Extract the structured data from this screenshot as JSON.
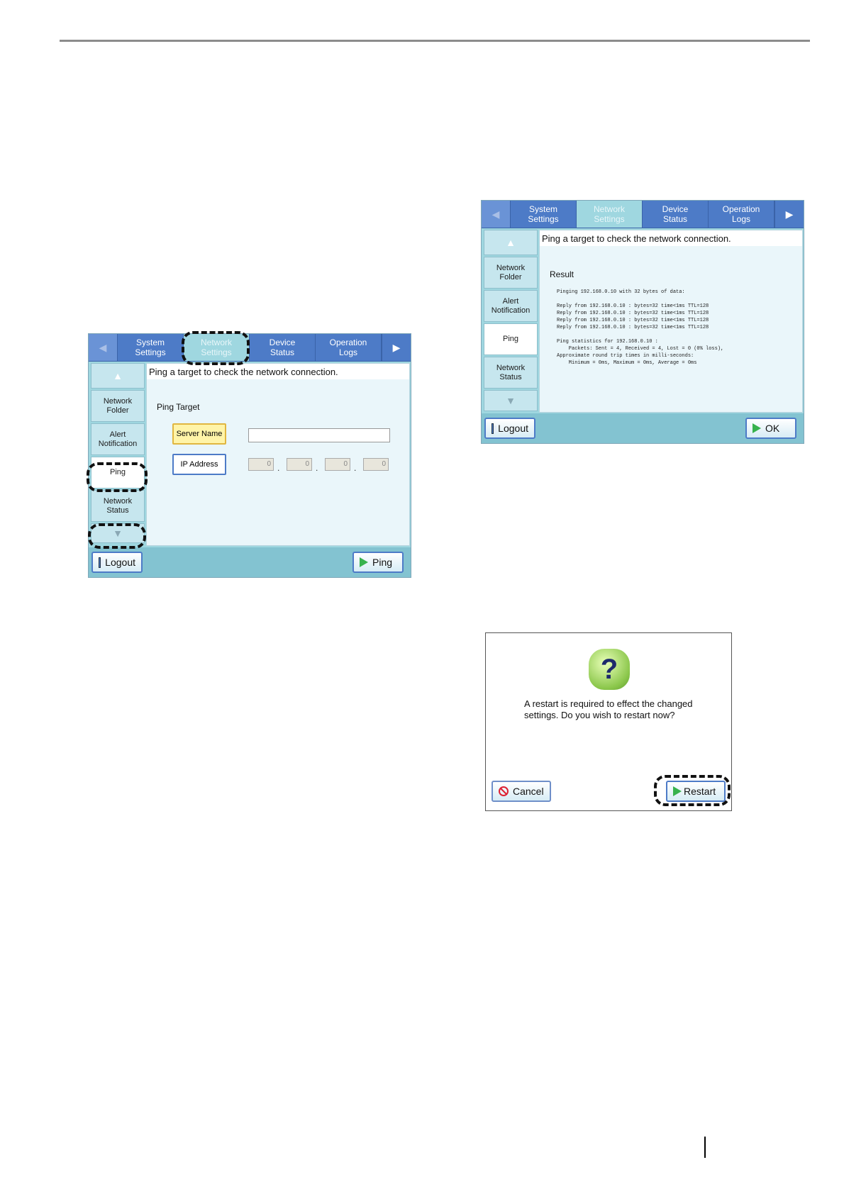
{
  "tabs": [
    {
      "label": "System\nSettings"
    },
    {
      "label": "Network\nSettings"
    },
    {
      "label": "Device\nStatus"
    },
    {
      "label": "Operation\nLogs"
    }
  ],
  "sidebar": {
    "scroll_up": "▲",
    "scroll_down": "▼",
    "items": [
      {
        "label": "Network\nFolder"
      },
      {
        "label": "Alert\nNotification"
      },
      {
        "label": "Ping"
      },
      {
        "label": "Network\nStatus"
      }
    ]
  },
  "ping_screen": {
    "instruction": "Ping a target to check the network connection.",
    "section_title": "Ping Target",
    "server_name_label": "Server Name",
    "ip_address_label": "IP Address",
    "ip_values": [
      "0",
      "0",
      "0",
      "0"
    ],
    "logout_label": "Logout",
    "ping_label": "Ping"
  },
  "result_screen": {
    "instruction": "Ping a target to check the network connection.",
    "result_title": "Result",
    "result_text": "Pinging 192.168.0.10 with 32 bytes of data:\n\nReply from 192.168.0.10 : bytes=32 time<1ms TTL=128\nReply from 192.168.0.10 : bytes=32 time<1ms TTL=128\nReply from 192.168.0.10 : bytes=32 time<1ms TTL=128\nReply from 192.168.0.10 : bytes=32 time<1ms TTL=128\n\nPing statistics for 192.168.0.10 :\n    Packets: Sent = 4, Received = 4, Lost = 0 (0% loss),\nApproximate round trip times in milli-seconds:\n    Minimum = 0ms, Maximum = 0ms, Average = 0ms",
    "logout_label": "Logout",
    "ok_label": "OK"
  },
  "restart_dialog": {
    "message": "A restart is required to effect the changed settings. Do you wish to restart now?",
    "cancel_label": "Cancel",
    "restart_label": "Restart"
  },
  "icons": {
    "question": "?",
    "left_arrow": "◀",
    "right_arrow": "▶"
  },
  "colors": {
    "tab_bar": "#4d7bc7",
    "screen_bg": "#9fd7e0",
    "go_arrow": "#37b24d",
    "highlight_field": "#fff4a8"
  }
}
